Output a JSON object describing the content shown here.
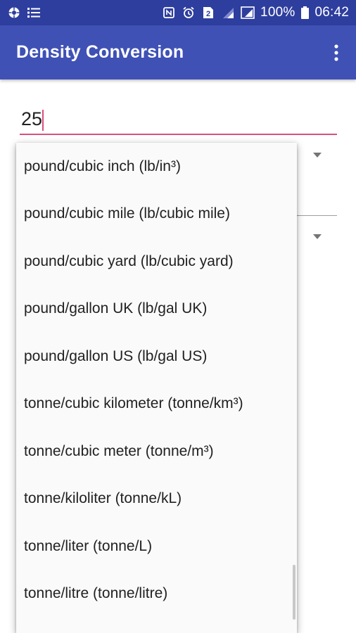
{
  "status_bar": {
    "left_icons": [
      "app-notification-icon",
      "list-notification-icon"
    ],
    "right_icons": [
      "nfc-icon",
      "alarm-icon",
      "sim-2-icon",
      "signal-icon",
      "signal-r-icon",
      "battery-icon"
    ],
    "battery": "100%",
    "time": "06:42"
  },
  "app_bar": {
    "title": "Density Conversion",
    "menu_icon": "overflow-menu-icon",
    "color": "#3f51b5"
  },
  "input": {
    "value": "25",
    "accent_color": "#d94f7e"
  },
  "dropdown": {
    "items": [
      "pound/cubic inch (lb/in³)",
      "pound/cubic mile (lb/cubic mile)",
      "pound/cubic yard (lb/cubic yard)",
      "pound/gallon UK (lb/gal UK)",
      "pound/gallon US (lb/gal US)",
      "tonne/cubic kilometer (tonne/km³)",
      "tonne/cubic meter (tonne/m³)",
      "tonne/kiloliter (tonne/kL)",
      "tonne/liter (tonne/L)",
      "tonne/litre (tonne/litre)"
    ]
  }
}
